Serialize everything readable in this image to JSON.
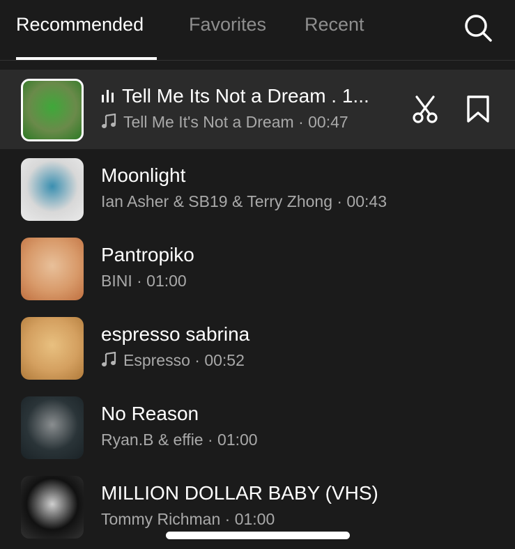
{
  "tabs": [
    {
      "label": "Recommended",
      "active": true
    },
    {
      "label": "Favorites",
      "active": false
    },
    {
      "label": "Recent",
      "active": false
    }
  ],
  "search": {
    "icon": "search-icon"
  },
  "tracks": [
    {
      "title": "Tell Me Its Not a Dream . 1...",
      "subtitle": "Tell Me It's Not a Dream · 00:47",
      "playing": true,
      "has_note_icon": true,
      "selected": true,
      "thumb_colors": [
        "#6a8a4a",
        "#3fa83a",
        "#2d7a25"
      ],
      "actions": [
        "scissors-icon",
        "bookmark-icon"
      ]
    },
    {
      "title": "Moonlight",
      "subtitle": "Ian Asher & SB19 & Terry Zhong · 00:43",
      "playing": false,
      "has_note_icon": false,
      "selected": false,
      "thumb_colors": [
        "#d8d8d8",
        "#3a8fb0",
        "#eaeaea"
      ]
    },
    {
      "title": "Pantropiko",
      "subtitle": "BINI · 01:00",
      "playing": false,
      "has_note_icon": false,
      "selected": false,
      "thumb_colors": [
        "#d89a6a",
        "#e8c09a",
        "#c07040"
      ]
    },
    {
      "title": "espresso sabrina",
      "subtitle": "Espresso · 00:52",
      "playing": false,
      "has_note_icon": true,
      "selected": false,
      "thumb_colors": [
        "#d4a060",
        "#e8c080",
        "#b07a3a"
      ]
    },
    {
      "title": "No Reason",
      "subtitle": "Ryan.B & effie · 01:00",
      "playing": false,
      "has_note_icon": false,
      "selected": false,
      "thumb_colors": [
        "#2a3438",
        "#8a8e90",
        "#1a2226"
      ]
    },
    {
      "title": "MILLION DOLLAR BABY (VHS)",
      "subtitle": "Tommy Richman · 01:00",
      "playing": false,
      "has_note_icon": false,
      "selected": false,
      "thumb_colors": [
        "#111111",
        "#cfcfcf",
        "#333333"
      ]
    }
  ]
}
